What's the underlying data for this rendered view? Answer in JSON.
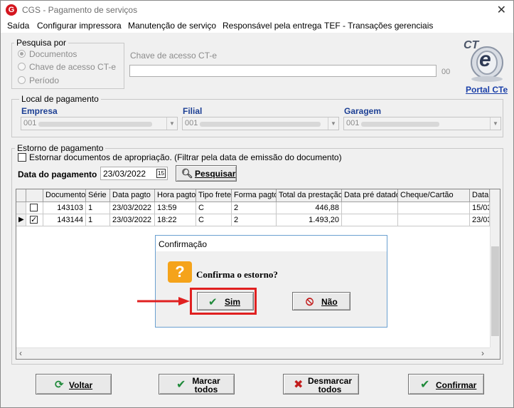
{
  "window": {
    "title": "CGS - Pagamento de serviços",
    "close_glyph": "✕"
  },
  "menu": [
    "Saída",
    "Configurar impressora",
    "Manutenção de serviço",
    "Responsável pela entrega",
    "TEF - Transações gerenciais"
  ],
  "search": {
    "legend": "Pesquisa por",
    "options": [
      "Documentos",
      "Chave de acesso CT-e",
      "Período"
    ],
    "selected": "Documentos",
    "key_label": "Chave de acesso CT-e",
    "key_value": "",
    "key_suffix": "00"
  },
  "cte": {
    "logo_text": "CT",
    "logo_e": "e",
    "portal_link": "Portal CTe"
  },
  "payment_location": {
    "legend": "Local de pagamento",
    "empresa_label": "Empresa",
    "empresa_value": "001",
    "filial_label": "Filial",
    "filial_value": "001",
    "garagem_label": "Garagem",
    "garagem_value": "001"
  },
  "reversal": {
    "legend": "Estorno de pagamento",
    "checkbox_label": "Estornar documentos de apropriação. (Filtrar pela data de emissão do documento)",
    "date_label": "Data do pagamento",
    "date_value": "23/03/2022",
    "calendar_glyph": "15",
    "search_button": "Pesquisar"
  },
  "grid": {
    "columns": [
      "Documento",
      "Série",
      "Data pagto",
      "Hora pagto",
      "Tipo frete",
      "Forma pagto",
      "Total da prestação",
      "Data pré datado",
      "Cheque/Cartão",
      "Data"
    ],
    "rows": [
      {
        "checked": false,
        "current": false,
        "cells": [
          "143103",
          "1",
          "23/03/2022",
          "13:59",
          "C",
          "2",
          "446,88",
          "",
          "",
          "15/03"
        ]
      },
      {
        "checked": true,
        "current": true,
        "cells": [
          "143144",
          "1",
          "23/03/2022",
          "18:22",
          "C",
          "2",
          "1.493,20",
          "",
          "",
          "23/03"
        ]
      }
    ]
  },
  "dialog": {
    "title": "Confirmação",
    "message": "Confirma o estorno?",
    "yes": "Sim",
    "no": "Não"
  },
  "buttons": {
    "back": "Voltar",
    "mark_all_1": "Marcar",
    "mark_all_2": "todos",
    "unmark_all_1": "Desmarcar",
    "unmark_all_2": "todos",
    "confirm": "Confirmar"
  },
  "colors": {
    "annotation": "#e02020",
    "label_blue": "#1c3f94",
    "link_blue": "#1a3fa8"
  },
  "icons": [
    "app-logo-icon",
    "question-icon",
    "check-icon",
    "forbidden-icon",
    "refresh-icon",
    "x-icon",
    "search-icon",
    "calendar-icon",
    "cte-logo-icon"
  ]
}
